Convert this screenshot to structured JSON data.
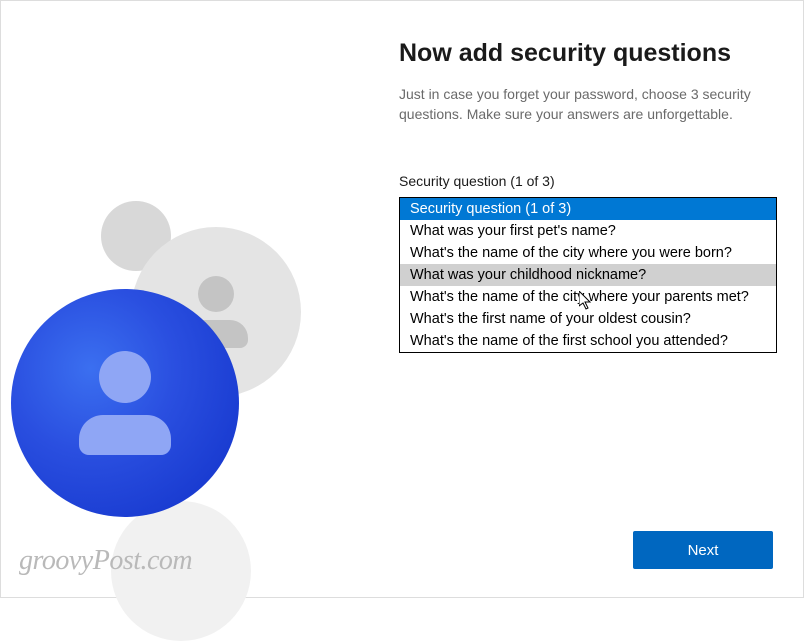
{
  "page": {
    "title": "Now add security questions",
    "subtitle": "Just in case you forget your password, choose 3 security questions. Make sure your answers are unforgettable."
  },
  "dropdown": {
    "label": "Security question (1 of 3)",
    "selected_index": 0,
    "hover_index": 3,
    "options": [
      "Security question (1 of 3)",
      "What was your first pet's name?",
      "What's the name of the city where you were born?",
      "What was your childhood nickname?",
      "What's the name of the city where your parents met?",
      "What's the first name of your oldest cousin?",
      "What's the name of the first school you attended?"
    ]
  },
  "footer": {
    "next_label": "Next"
  },
  "watermark": "groovyPost.com",
  "colors": {
    "accent": "#0067c0",
    "selection": "#0078d4"
  }
}
